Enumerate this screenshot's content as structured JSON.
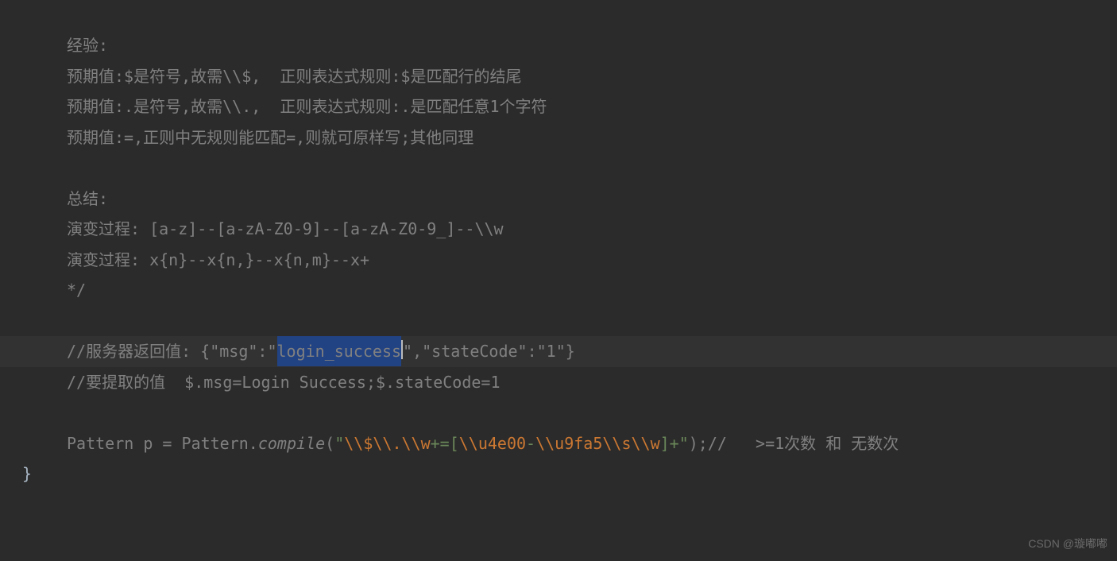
{
  "lines": {
    "l1": "经验:",
    "l2": "预期值:$是符号,故需\\\\$,  正则表达式规则:$是匹配行的结尾",
    "l3": "预期值:.是符号,故需\\\\.,  正则表达式规则:.是匹配任意1个字符",
    "l4": "预期值:=,正则中无规则能匹配=,则就可原样写;其他同理",
    "l5": "",
    "l6": "总结:",
    "l7": "演变过程: [a-z]--[a-zA-Z0-9]--[a-zA-Z0-9_]--\\\\w",
    "l8": "演变过程: x{n}--x{n,}--x{n,m}--x+",
    "l9": "*/",
    "l10": "",
    "l11_pre": "//服务器返回值: {\"msg\":\"",
    "l11_sel": "login_success",
    "l11_post": "\",\"stateCode\":\"1\"}",
    "l12": "//要提取的值  $.msg=Login Success;$.stateCode=1",
    "l13": "",
    "l14_p1": "Pattern ",
    "l14_p2": "p ",
    "l14_p3": "= Pattern.",
    "l14_p4": "compile",
    "l14_p5": "(",
    "l14_s1": "\"",
    "l14_e1": "\\\\$\\\\.\\\\w",
    "l14_s2": "+=[",
    "l14_e2": "\\\\u4e00",
    "l14_s3": "-",
    "l14_e3": "\\\\u9fa5\\\\s\\\\w",
    "l14_s4": "]+\"",
    "l14_p6": ");",
    "l14_c": "//   >=1次数 和 无数次",
    "l15": "}"
  },
  "watermark": "CSDN @璇嘟嘟"
}
